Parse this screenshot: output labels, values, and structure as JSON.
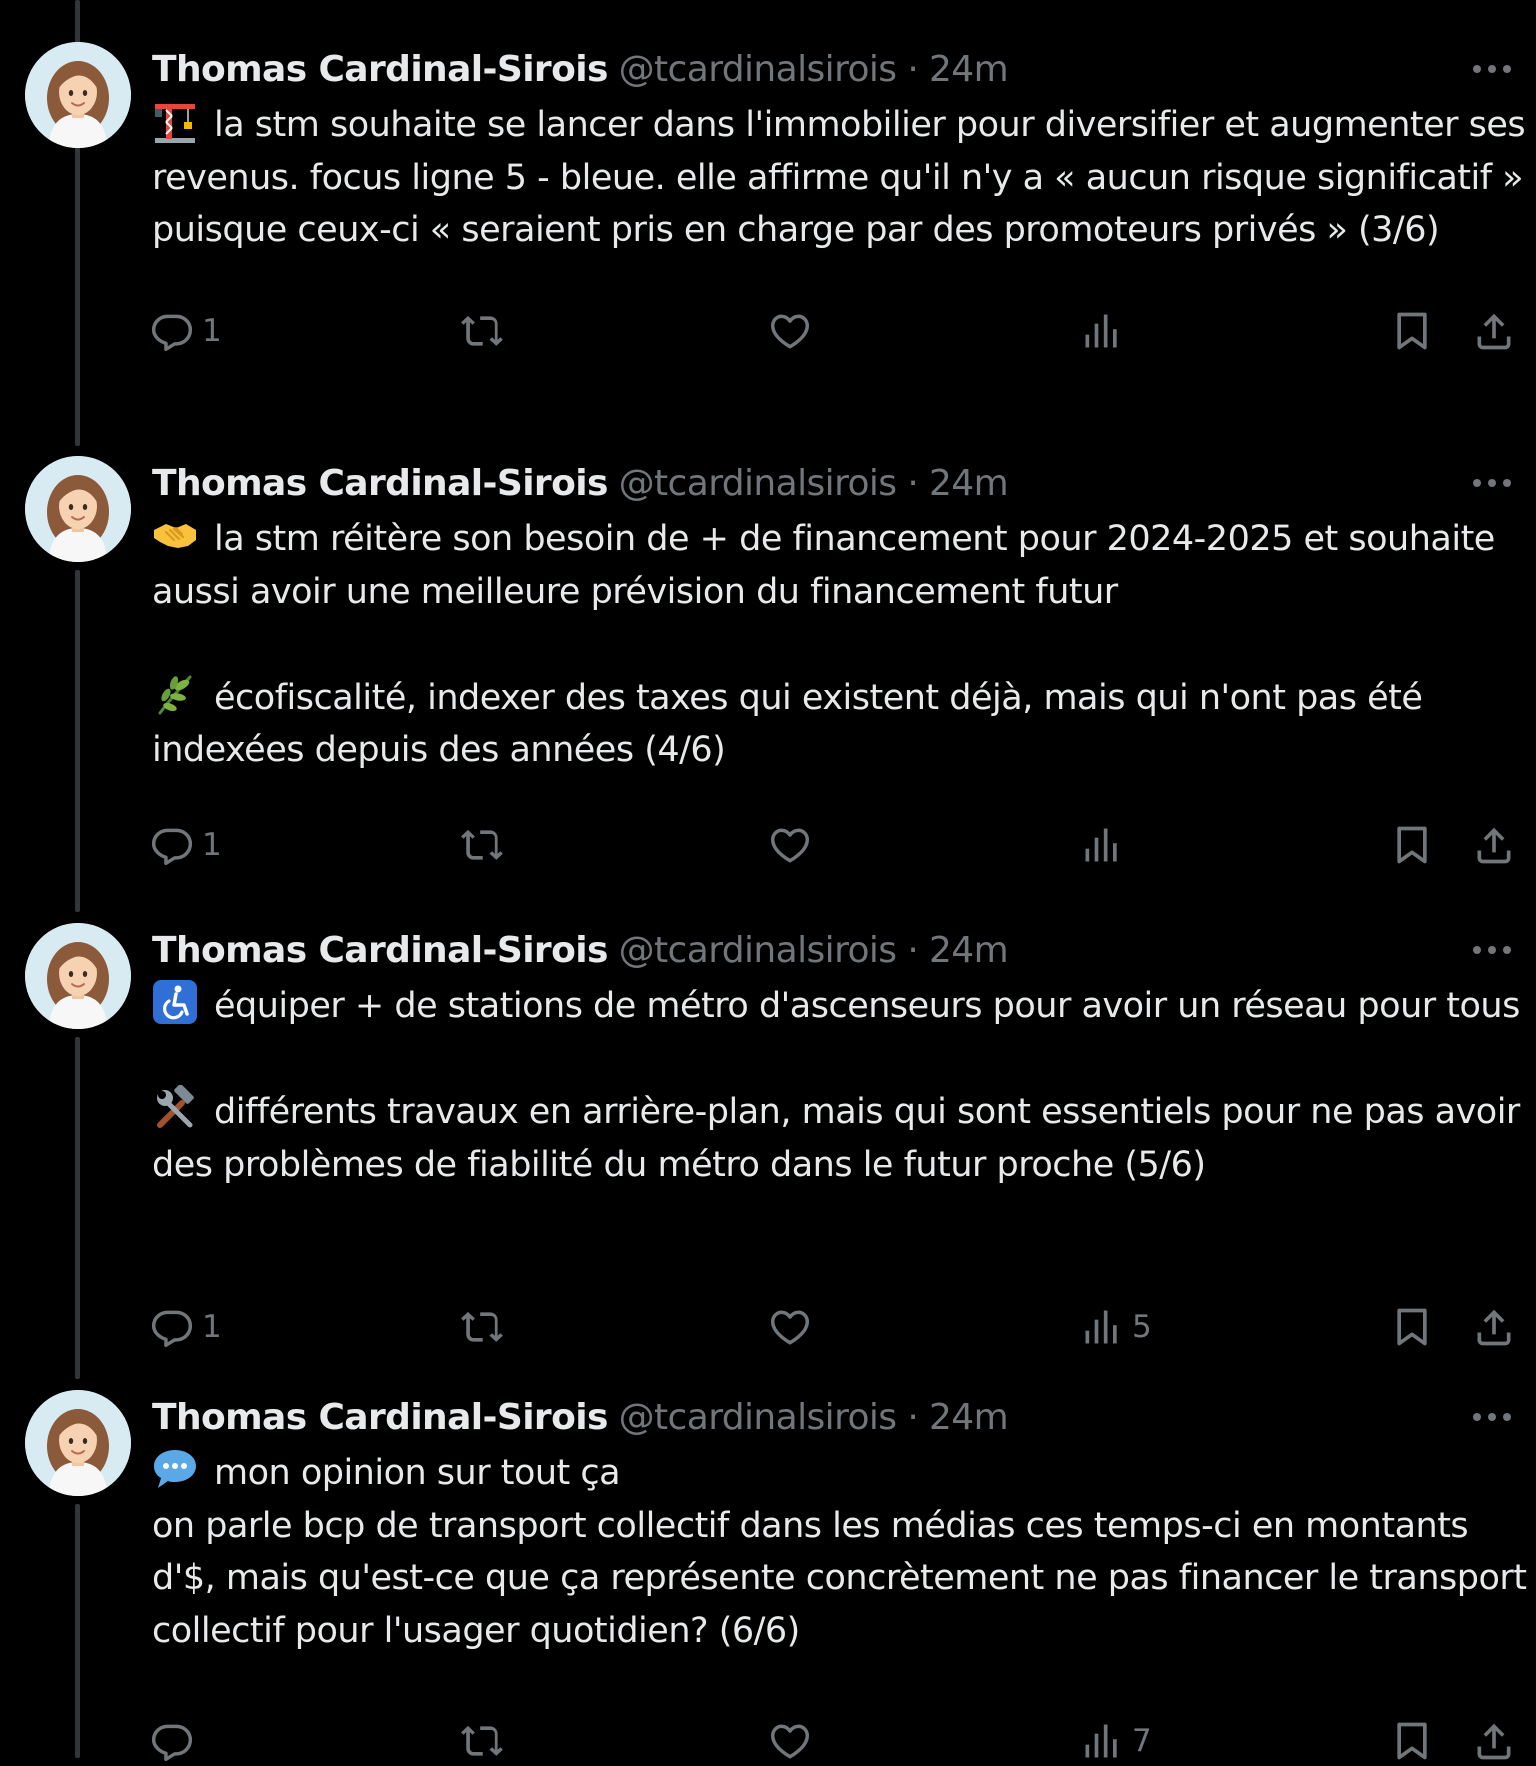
{
  "tweets": [
    {
      "author": {
        "name": "Thomas Cardinal-Sirois",
        "handle": "@tcardinalsirois",
        "separator": "·",
        "time": "24m"
      },
      "paragraphs": [
        {
          "emoji": "construction-crane-emoji",
          "text": "la stm souhaite se lancer dans l'immobilier pour diversifier et augmenter ses revenus. focus ligne 5 - bleue. elle affirme qu'il n'y a « aucun risque significatif » puisque ceux-ci « seraient pris en charge par des promoteurs privés » (3/6)"
        }
      ],
      "stats": {
        "replies": "1",
        "reposts": "",
        "likes": "",
        "views": ""
      }
    },
    {
      "author": {
        "name": "Thomas Cardinal-Sirois",
        "handle": "@tcardinalsirois",
        "separator": "·",
        "time": "24m"
      },
      "paragraphs": [
        {
          "emoji": "handshake-emoji",
          "text": "la stm réitère son besoin de + de financement pour 2024-2025 et souhaite aussi avoir une meilleure prévision du financement futur"
        },
        {
          "emoji": "herb-emoji",
          "text": "écofiscalité, indexer des taxes qui existent déjà, mais qui n'ont pas été indexées depuis des années (4/6)"
        }
      ],
      "stats": {
        "replies": "1",
        "reposts": "",
        "likes": "",
        "views": ""
      }
    },
    {
      "author": {
        "name": "Thomas Cardinal-Sirois",
        "handle": "@tcardinalsirois",
        "separator": "·",
        "time": "24m"
      },
      "paragraphs": [
        {
          "emoji": "wheelchair-symbol-emoji",
          "text": "équiper + de stations de métro d'ascenseurs pour avoir un réseau pour tous"
        },
        {
          "emoji": "hammer-and-wrench-emoji",
          "text": "différents travaux en arrière-plan, mais qui sont essentiels pour ne pas avoir des problèmes de fiabilité du métro dans le futur proche (5/6)"
        }
      ],
      "stats": {
        "replies": "1",
        "reposts": "",
        "likes": "",
        "views": "5"
      }
    },
    {
      "author": {
        "name": "Thomas Cardinal-Sirois",
        "handle": "@tcardinalsirois",
        "separator": "·",
        "time": "24m"
      },
      "paragraphs": [
        {
          "emoji": "speech-balloon-emoji",
          "text": "mon opinion sur tout ça",
          "continuation": "on parle bcp de transport collectif dans les médias ces temps-ci en montants d'$, mais qu'est-ce que ça représente concrètement ne pas financer le transport collectif pour l'usager quotidien? (6/6)"
        }
      ],
      "stats": {
        "replies": "",
        "reposts": "",
        "likes": "",
        "views": "7"
      }
    }
  ],
  "icons": {
    "reply": "reply-icon",
    "repost": "repost-icon",
    "like": "like-icon",
    "views": "views-icon",
    "bookmark": "bookmark-icon",
    "share": "share-icon",
    "more": "more-icon"
  },
  "colors": {
    "background": "#000000",
    "primary_text": "#e7e9ea",
    "secondary_text": "#71767b",
    "thread_line": "#333639"
  }
}
